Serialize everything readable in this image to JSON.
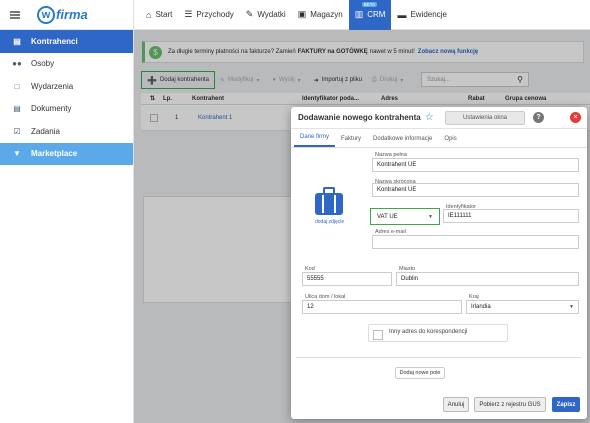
{
  "app": {
    "logo_letter": "w",
    "logo_text": "firma"
  },
  "sidebar": {
    "items": [
      {
        "label": "Kontrahenci",
        "icon": "id-card-icon"
      },
      {
        "label": "Osoby",
        "icon": "users-icon"
      },
      {
        "label": "Wydarzenia",
        "icon": "events-icon"
      },
      {
        "label": "Dokumenty",
        "icon": "documents-icon"
      },
      {
        "label": "Zadania",
        "icon": "tasks-icon"
      },
      {
        "label": "Marketplace",
        "icon": "cart-icon"
      }
    ]
  },
  "topnav": {
    "items": [
      {
        "label": "Start",
        "icon": "home-icon"
      },
      {
        "label": "Przychody",
        "icon": "income-icon"
      },
      {
        "label": "Wydatki",
        "icon": "expenses-icon"
      },
      {
        "label": "Magazyn",
        "icon": "warehouse-icon"
      },
      {
        "label": "CRM",
        "icon": "crm-icon",
        "badge": "BETA"
      },
      {
        "label": "Ewidencje",
        "icon": "folder-icon"
      }
    ]
  },
  "banner": {
    "text_before": "Za długie terminy płatności na fakturze? Zamień",
    "bold": "FAKTURY na GOTÓWKĘ",
    "text_after": "nawet w 5 minut!",
    "link": "Zobacz nową funkcję"
  },
  "toolbar": {
    "add": "Dodaj kontrahenta",
    "modify": "Modyfikuj",
    "send": "Wyślij",
    "import": "Importuj z pliku",
    "print": "Drukuj",
    "search_placeholder": "Szukaj..."
  },
  "table": {
    "headers": {
      "lp": "Lp.",
      "contractor": "Kontrahent",
      "identifier": "Identyfikator poda...",
      "address": "Adres",
      "discount": "Rabat",
      "price_group": "Grupa cenowa"
    },
    "rows": [
      {
        "lp": "1",
        "name": "Kontrahent 1"
      }
    ]
  },
  "modal": {
    "title": "Dodawanie nowego kontrahenta",
    "settings_button": "Ustawienia okna",
    "help": "?",
    "close": "×",
    "tabs": [
      "Dane firmy",
      "Faktury",
      "Dodatkowe informacje",
      "Opis"
    ],
    "add_photo": "dodaj zdjęcie",
    "fields": {
      "full_name_label": "Nazwa pełna",
      "full_name": "Kontrahent UE",
      "short_name_label": "Nazwa skrócona",
      "short_name": "Kontrahent UE",
      "vat_type": "VAT UE",
      "identifier_label": "Identyfikator",
      "identifier": "IE111111",
      "email_label": "Adres e-mail",
      "email": "",
      "postcode_label": "Kod",
      "postcode": "55555",
      "city_label": "Miasto",
      "city": "Dublin",
      "street_label": "Ulica dom / lokal",
      "street": "12",
      "country_label": "Kraj",
      "country": "Irlandia"
    },
    "other_address": "Inny adres do korespondencji",
    "add_field": "Dodaj nowe pole",
    "cancel": "Anuluj",
    "gus": "Pobierz z rejestru GUS",
    "save": "Zapisz"
  },
  "colors": {
    "accent": "#2f67c7",
    "marketplace": "#5ca9e9",
    "highlight": "#3aaa4a",
    "danger": "#e53935"
  }
}
